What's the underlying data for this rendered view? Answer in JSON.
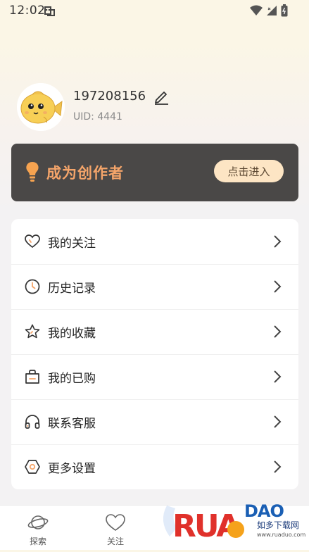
{
  "status_bar": {
    "time": "12:02"
  },
  "profile": {
    "username": "197208156",
    "uid": "UID: 4441"
  },
  "creator": {
    "title": "成为创作者",
    "button": "点击进入"
  },
  "menu": [
    {
      "label": "我的关注",
      "icon": "heart-icon"
    },
    {
      "label": "历史记录",
      "icon": "clock-icon"
    },
    {
      "label": "我的收藏",
      "icon": "star-icon"
    },
    {
      "label": "我的已购",
      "icon": "bag-icon"
    },
    {
      "label": "联系客服",
      "icon": "headphones-icon"
    },
    {
      "label": "更多设置",
      "icon": "settings-icon"
    }
  ],
  "tabs": [
    {
      "label": "探索",
      "icon": "planet-icon"
    },
    {
      "label": "关注",
      "icon": "heart-icon"
    }
  ],
  "watermark": {
    "text": "RUANDAO",
    "subtext": "如多下载网",
    "url": "www.ruaduo.com"
  },
  "colors": {
    "banner_bg": "#4a4847",
    "banner_title": "#f5a56a",
    "banner_button": "#fde5c4"
  }
}
